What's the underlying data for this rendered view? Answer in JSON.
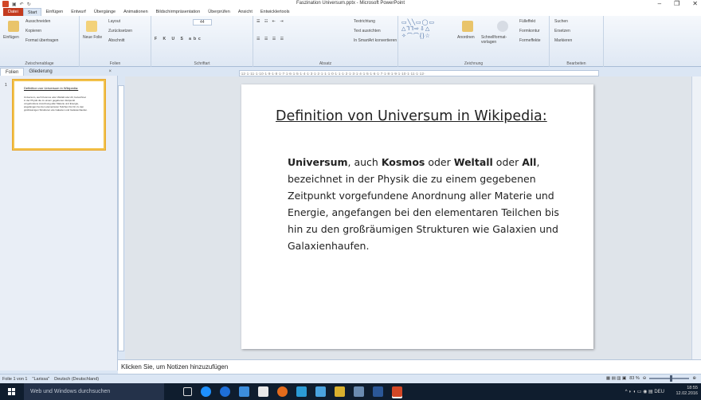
{
  "window": {
    "title": "Faszination Universum.pptx - Microsoft PowerPoint",
    "minimize": "–",
    "restore": "❐",
    "close": "✕"
  },
  "ribbon_tabs": [
    "Datei",
    "Start",
    "Einfügen",
    "Entwurf",
    "Übergänge",
    "Animationen",
    "Bildschirmpräsentation",
    "Überprüfen",
    "Ansicht",
    "Entwicklertools"
  ],
  "clipboard": {
    "paste": "Einfügen",
    "cut": "Ausschneiden",
    "copy": "Kopieren",
    "format_painter": "Format übertragen",
    "label": "Zwischenablage"
  },
  "slides_group": {
    "new_slide": "Neue Folie",
    "layout": "Layout",
    "reset": "Zurücksetzen",
    "section": "Abschnitt",
    "label": "Folien"
  },
  "font_group": {
    "size": "44",
    "label": "Schriftart"
  },
  "paragraph_group": {
    "text_direction": "Textrichtung",
    "align_text": "Text ausrichten",
    "smartart": "In SmartArt konvertieren",
    "label": "Absatz"
  },
  "drawing_group": {
    "arrange": "Anordnen",
    "quick_styles": "Schnellformat-vorlagen",
    "fill": "Fülleffekt",
    "outline": "Formkontur",
    "effects": "Formeffekte",
    "label": "Zeichnung"
  },
  "editing_group": {
    "find": "Suchen",
    "replace": "Ersetzen",
    "select": "Markieren",
    "label": "Bearbeiten"
  },
  "panel_tabs": {
    "slides": "Folien",
    "outline": "Gliederung",
    "close": "×"
  },
  "thumbnail": {
    "number": "1",
    "title": "Definition von Universum in Wikipedia:",
    "body": "Universum, auch Kosmos oder Weltall oder All, bezeichnet in der Physik die zu einem gegebenen Zeitpunkt vorgefundene Anordnung aller Materie und Energie, angefangen bei den elementaren Teilchen bis hin zu den großräumigen Strukturen wie Galaxien und Galaxienhaufen."
  },
  "ruler": "·12·1·11·1·10·1·9·1·8·1·7·1·6·1·5·1·4·1·3·1·2·1·1·1·0·1·1·1·2·1·3·1·4·1·5·1·6·1·7·1·8·1·9·1·10·1·11·1·12·",
  "slide": {
    "title": "Definition von Universum in Wikipedia:",
    "body_parts": [
      {
        "text": "Universum",
        "bold": true
      },
      {
        "text": ", auch ",
        "bold": false
      },
      {
        "text": "Kosmos",
        "bold": true
      },
      {
        "text": " oder ",
        "bold": false
      },
      {
        "text": "Weltall",
        "bold": true
      },
      {
        "text": " oder ",
        "bold": false
      },
      {
        "text": "All",
        "bold": true
      },
      {
        "text": ", bezeichnet in der Physik die zu einem gegebenen Zeitpunkt vorgefundene Anordnung aller Materie und Energie, angefangen bei den elementaren Teilchen bis hin zu den großräumigen Strukturen wie Galaxien und Galaxienhaufen.",
        "bold": false
      }
    ]
  },
  "notes": {
    "placeholder": "Klicken Sie, um Notizen hinzuzufügen"
  },
  "status": {
    "slide": "Folie 1 von 1",
    "theme": "\"Larissa\"",
    "language": "Deutsch (Deutschland)",
    "zoom": "83 %"
  },
  "taskbar": {
    "search": "Web und Windows durchsuchen",
    "time": "18:55",
    "date": "12.02.2016",
    "lang": "DEU"
  },
  "colors": {
    "accent": "#c33b1f",
    "selection": "#f2c24b",
    "taskbar": "#0f1d2e"
  }
}
